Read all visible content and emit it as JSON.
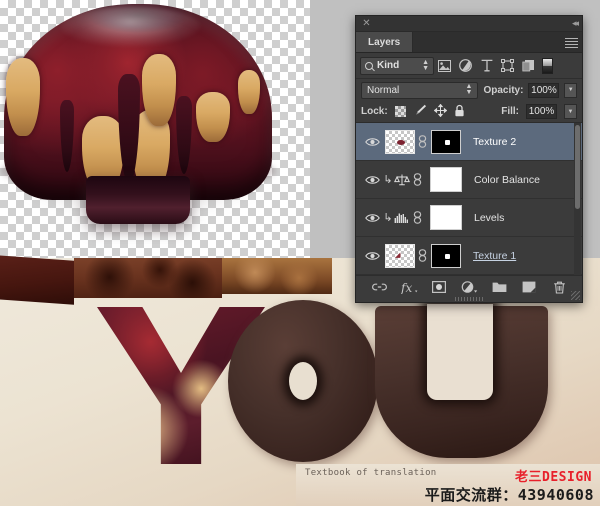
{
  "app": {
    "panel_title": "Layers",
    "close_icon": "close-icon",
    "collapse_icon": "collapse-panel-icon",
    "menu_icon": "panel-menu-icon"
  },
  "filter": {
    "kind_label": "Kind",
    "search_icon": "search-icon",
    "icons": [
      "pixel-layer-filter-icon",
      "adjustment-layer-filter-icon",
      "type-layer-filter-icon",
      "shape-layer-filter-icon",
      "smart-object-filter-icon"
    ],
    "toggle_icon": "filter-toggle-switch"
  },
  "blend": {
    "mode": "Normal",
    "opacity_label": "Opacity:",
    "opacity_value": "100%",
    "fill_label": "Fill:",
    "fill_value": "100%"
  },
  "lock": {
    "label": "Lock:",
    "icons": [
      "lock-transparent-pixels-icon",
      "lock-image-pixels-icon",
      "lock-position-icon",
      "lock-all-icon"
    ]
  },
  "layers": [
    {
      "name": "Texture 2",
      "type": "pixel",
      "selected": true,
      "visible": true,
      "has_mask": true,
      "clipped": false,
      "underlined": false
    },
    {
      "name": "Color Balance",
      "type": "adjustment",
      "selected": false,
      "visible": true,
      "has_mask": true,
      "clipped": true,
      "underlined": false
    },
    {
      "name": "Levels",
      "type": "adjustment",
      "selected": false,
      "visible": true,
      "has_mask": true,
      "clipped": true,
      "underlined": false
    },
    {
      "name": "Texture 1",
      "type": "pixel",
      "selected": false,
      "visible": true,
      "has_mask": true,
      "clipped": false,
      "underlined": true
    }
  ],
  "footer": {
    "buttons": [
      "link-layers-icon",
      "layer-style-fx-icon",
      "add-layer-mask-icon",
      "new-adjustment-layer-icon",
      "new-group-icon",
      "new-layer-icon",
      "delete-layer-icon"
    ]
  },
  "canvas": {
    "note_text": "Textbook of translation",
    "letters": [
      "Y",
      "O",
      "U"
    ]
  },
  "watermark": {
    "brand": "老三DESIGN",
    "qq_line": "平面交流群：43940608",
    "brand_color": "#e8202a"
  }
}
